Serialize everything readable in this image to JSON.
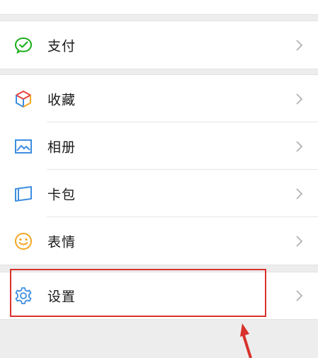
{
  "menu_groups": [
    {
      "items": [
        {
          "label": "支付",
          "icon": "wechat-pay-icon"
        }
      ]
    },
    {
      "items": [
        {
          "label": "收藏",
          "icon": "favorites-cube-icon"
        },
        {
          "label": "相册",
          "icon": "album-picture-icon"
        },
        {
          "label": "卡包",
          "icon": "card-wallet-icon"
        },
        {
          "label": "表情",
          "icon": "emoji-smile-icon"
        }
      ]
    },
    {
      "items": [
        {
          "label": "设置",
          "icon": "gear-icon"
        }
      ]
    }
  ],
  "colors": {
    "pay_green": "#1aad19",
    "icon_blue": "#3d8ee0",
    "emoji_orange": "#f5a623",
    "highlight_red": "#d9322c",
    "background": "#ededed"
  },
  "annotation": {
    "highlight": "red-rectangle",
    "arrow": "red-arrow-pointing-up"
  }
}
